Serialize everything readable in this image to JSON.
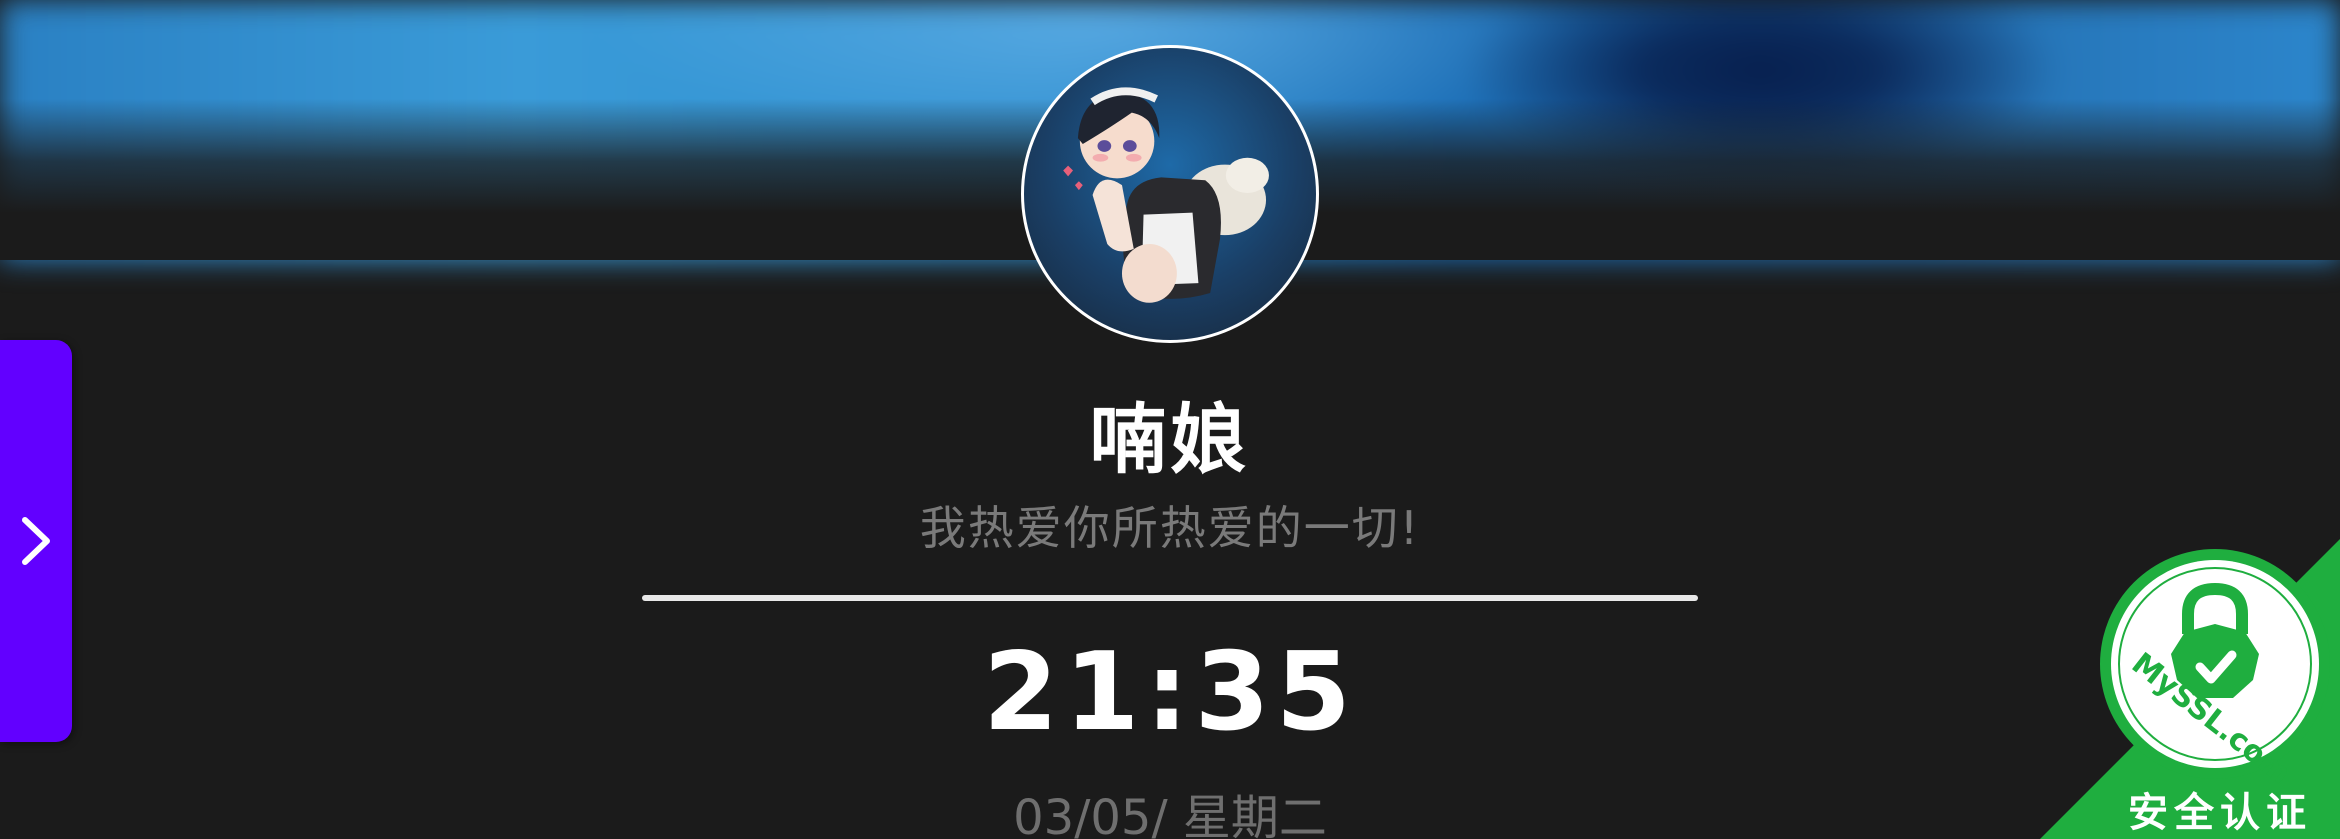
{
  "profile": {
    "name": "喃娘",
    "motto": "我热爱你所热爱的一切!"
  },
  "clock": {
    "time": "21:35",
    "date": "03/05/ 星期二"
  },
  "sidebar_toggle": {
    "icon": "chevron-right-icon",
    "color": "#6200ff"
  },
  "seal": {
    "brand": "MySSL.com",
    "label": "安全认证",
    "color": "#1fae3f"
  },
  "colors": {
    "background": "#1b1b1b",
    "banner": "#2f8fd0"
  }
}
